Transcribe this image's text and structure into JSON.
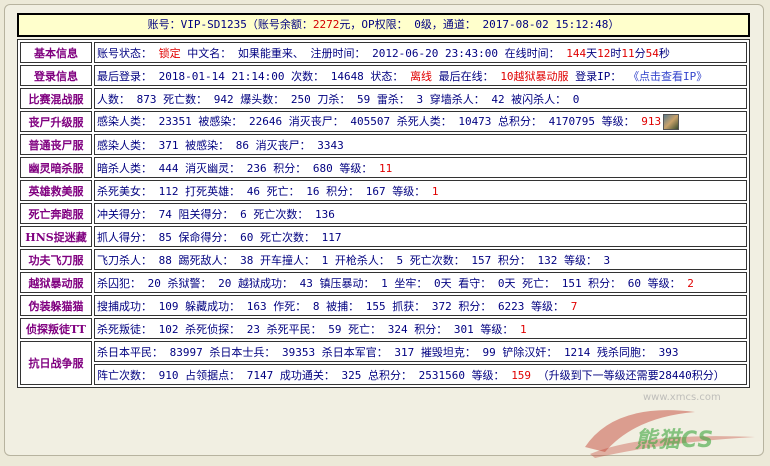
{
  "header": {
    "p1": "账号：VIP-SD1235（账号余额：",
    "balance": "2272",
    "p2": "元，OP权限： 0级，通道： 2017-08-02 15:12:48）"
  },
  "rows": [
    {
      "cat": "基本信息",
      "segs": [
        {
          "t": "账号状态： "
        },
        {
          "t": "锁定",
          "c": "r"
        },
        {
          "t": " 中文名： "
        },
        {
          "t": "如果能重来、",
          "c": "v"
        },
        {
          "t": " 注册时间： 2012-06-20 23:43:00 在线时间： "
        },
        {
          "t": "144",
          "c": "r"
        },
        {
          "t": "天"
        },
        {
          "t": "12",
          "c": "r"
        },
        {
          "t": "时"
        },
        {
          "t": "11",
          "c": "r"
        },
        {
          "t": "分"
        },
        {
          "t": "54",
          "c": "r"
        },
        {
          "t": "秒"
        }
      ]
    },
    {
      "cat": "登录信息",
      "segs": [
        {
          "t": "最后登录： 2018-01-14 21:14:00 次数： 14648 状态： "
        },
        {
          "t": "离线",
          "c": "r"
        },
        {
          "t": " 最后在线： "
        },
        {
          "t": "10越狱暴动服",
          "c": "r"
        },
        {
          "t": " 登录IP： "
        },
        {
          "t": "《点击查看IP》",
          "c": "link"
        }
      ]
    },
    {
      "cat": "比赛混战服",
      "segs": [
        {
          "t": "人数： 873 死亡数： 942 爆头数： 250 刀杀： 59 雷杀： 3 穿墙杀人： 42 被闪杀人： 0"
        }
      ]
    },
    {
      "cat": "丧尸升级服",
      "segs": [
        {
          "t": "感染人类： 23351 被感染： 22646 消灭丧尸： 405507 杀死人类： 10473 总积分： 4170795 等级： "
        },
        {
          "t": "913",
          "c": "r"
        }
      ],
      "avatar": true
    },
    {
      "cat": "普通丧尸服",
      "segs": [
        {
          "t": "感染人类： 371 被感染： 86 消灭丧尸： 3343"
        }
      ]
    },
    {
      "cat": "幽灵暗杀服",
      "segs": [
        {
          "t": "暗杀人类： 444 消灭幽灵： 236 积分： 680 等级： "
        },
        {
          "t": "11",
          "c": "r"
        }
      ]
    },
    {
      "cat": "英雄救美服",
      "segs": [
        {
          "t": "杀死美女： 112 打死英雄： 46 死亡： 16 积分： 167 等级： "
        },
        {
          "t": "1",
          "c": "r"
        }
      ]
    },
    {
      "cat": "死亡奔跑服",
      "segs": [
        {
          "t": "冲关得分： 74 阻关得分： 6 死亡次数： 136"
        }
      ]
    },
    {
      "cat": "HNS捉迷藏",
      "segs": [
        {
          "t": "抓人得分： 85 保命得分： 60 死亡次数： 117"
        }
      ]
    },
    {
      "cat": "功夫飞刀服",
      "segs": [
        {
          "t": "飞刀杀人： 88 踢死敌人： 38 开车撞人： 1 开枪杀人： 5 死亡次数： 157 积分： 132 等级： 3"
        }
      ]
    },
    {
      "cat": "越狱暴动服",
      "segs": [
        {
          "t": "杀囚犯： 20 杀狱警： 20 越狱成功： 43 镇压暴动： 1 坐牢： 0天 看守： 0天 死亡： 151 积分： 60 等级： "
        },
        {
          "t": "2",
          "c": "r"
        }
      ]
    },
    {
      "cat": "伪装躲猫猫",
      "segs": [
        {
          "t": "搜捕成功： 109 躲藏成功： 163 作死： 8 被捕： 155 抓获： 372 积分： 6223 等级： "
        },
        {
          "t": "7",
          "c": "r"
        }
      ]
    },
    {
      "cat": "侦探叛徒TT",
      "segs": [
        {
          "t": "杀死叛徒： 102 杀死侦探： 23 杀死平民： 59 死亡： 324 积分： 301 等级： "
        },
        {
          "t": "1",
          "c": "r"
        }
      ]
    }
  ],
  "last_row": {
    "cat": "抗日战争服",
    "line1": [
      {
        "t": "杀日本平民： 83997 杀日本士兵： 39353 杀日本军官： 317 摧毁坦克： 99 铲除汉奸： 1214 残杀同胞： 393"
      }
    ],
    "line2": [
      {
        "t": "阵亡次数： 910 占领据点： 7147 成功通关： 325 总积分： 2531560 等级： "
      },
      {
        "t": "159",
        "c": "r"
      },
      {
        "t": " （升级到下一等级还需要28440积分）"
      }
    ]
  },
  "watermark": {
    "text": "熊猫CS",
    "url": "www.xmcs.com"
  }
}
